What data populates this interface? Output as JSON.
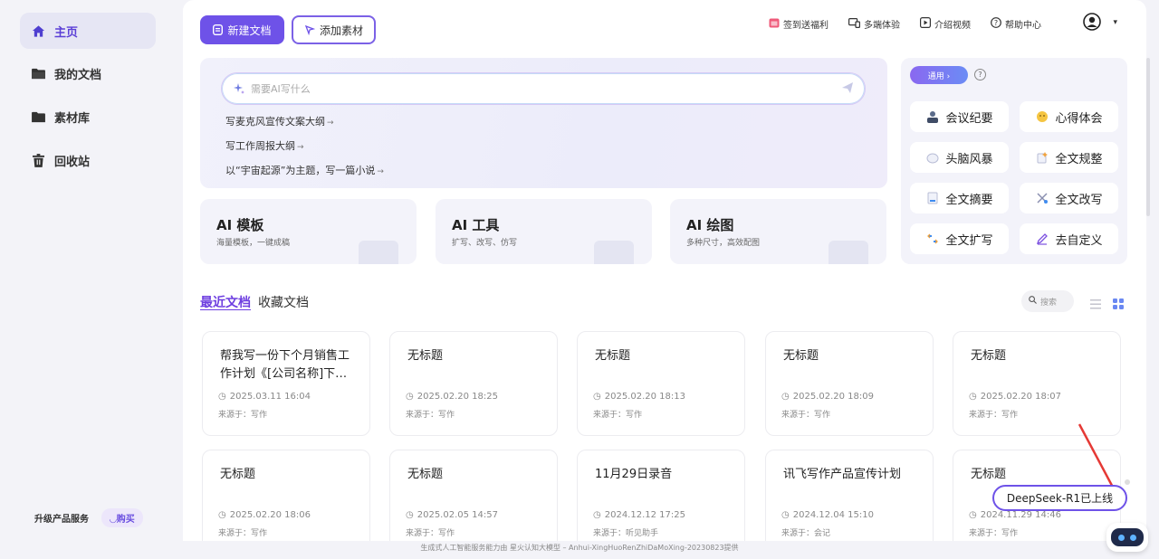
{
  "sidebar": {
    "items": [
      {
        "label": "主页",
        "icon": "home-icon",
        "active": true
      },
      {
        "label": "我的文档",
        "icon": "folder-icon"
      },
      {
        "label": "素材库",
        "icon": "folder-icon"
      },
      {
        "label": "回收站",
        "icon": "trash-icon"
      }
    ],
    "upgrade_label": "升级产品服务",
    "buy_label": "购买"
  },
  "toolbar": {
    "new_doc_label": "新建文档",
    "add_material_label": "添加素材"
  },
  "top_links": [
    {
      "label": "签到送福利",
      "icon": "calendar-gift-icon"
    },
    {
      "label": "多端体验",
      "icon": "devices-icon"
    },
    {
      "label": "介绍视频",
      "icon": "play-icon"
    },
    {
      "label": "帮助中心",
      "icon": "help-icon"
    }
  ],
  "prompt": {
    "placeholder": "需要AI写什么",
    "suggestions": [
      "写麦克风宣传文案大纲",
      "写工作周报大纲",
      "以“宇宙起源”为主题，写一篇小说"
    ]
  },
  "features": [
    {
      "title": "AI 模板",
      "subtitle": "海量模板，一键成稿"
    },
    {
      "title": "AI 工具",
      "subtitle": "扩写、改写、仿写"
    },
    {
      "title": "AI 绘图",
      "subtitle": "多种尺寸，高效配图"
    }
  ],
  "quick": {
    "tag_label": "通用 ›",
    "help": "?",
    "items": [
      {
        "label": "会议纪要",
        "icon": "meeting-icon"
      },
      {
        "label": "心得体会",
        "icon": "thinking-icon"
      },
      {
        "label": "头脑风暴",
        "icon": "brain-icon"
      },
      {
        "label": "全文规整",
        "icon": "organize-icon"
      },
      {
        "label": "全文摘要",
        "icon": "summary-icon"
      },
      {
        "label": "全文改写",
        "icon": "rewrite-icon"
      },
      {
        "label": "全文扩写",
        "icon": "expand-icon"
      },
      {
        "label": "去自定义",
        "icon": "pencil-icon"
      }
    ]
  },
  "tabs": [
    {
      "label": "最近文档",
      "active": true
    },
    {
      "label": "收藏文档",
      "active": false
    }
  ],
  "search_placeholder": "搜索",
  "docs": [
    {
      "title": "帮我写一份下个月销售工作计划《[公司名称]下个月销售工作计划》",
      "date": "2025.03.11 16:04",
      "source": "来源于：写作"
    },
    {
      "title": "无标题",
      "date": "2025.02.20 18:25",
      "source": "来源于：写作"
    },
    {
      "title": "无标题",
      "date": "2025.02.20 18:13",
      "source": "来源于：写作"
    },
    {
      "title": "无标题",
      "date": "2025.02.20 18:09",
      "source": "来源于：写作"
    },
    {
      "title": "无标题",
      "date": "2025.02.20 18:07",
      "source": "来源于：写作"
    },
    {
      "title": "无标题",
      "date": "2025.02.20 18:06",
      "source": "来源于：写作"
    },
    {
      "title": "无标题",
      "date": "2025.02.05 14:57",
      "source": "来源于：写作"
    },
    {
      "title": "11月29日录音",
      "date": "2024.12.12 17:25",
      "source": "来源于：听见助手"
    },
    {
      "title": "讯飞写作产品宣传计划",
      "date": "2024.12.04 15:10",
      "source": "来源于：会记"
    },
    {
      "title": "无标题",
      "date": "2024.11.29 14:46",
      "source": "来源于：写作"
    }
  ],
  "footer": "生成式人工智能服务能力由 星火认知大模型 – Anhui-XingHuoRenZhiDaMoXing-20230823提供",
  "deepseek_bubble": "DeepSeek-R1已上线",
  "colors": {
    "accent": "#6e52e8",
    "annotation_arrow": "#e53935"
  }
}
